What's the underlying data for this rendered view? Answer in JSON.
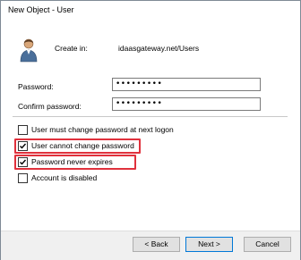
{
  "window": {
    "title": "New Object - User"
  },
  "header": {
    "create_in_label": "Create in:",
    "create_in_path": "idaasgateway.net/Users",
    "icon": "user-icon"
  },
  "fields": {
    "password": {
      "label": "Password:",
      "value": "•••••••••"
    },
    "confirm_password": {
      "label": "Confirm password:",
      "value": "•••••••••"
    }
  },
  "options": [
    {
      "label": "User must change password at next logon",
      "checked": false,
      "highlighted": false
    },
    {
      "label": "User cannot change password",
      "checked": true,
      "highlighted": true
    },
    {
      "label": "Password never expires",
      "checked": true,
      "highlighted": true
    },
    {
      "label": "Account is disabled",
      "checked": false,
      "highlighted": false
    }
  ],
  "buttons": {
    "back": "< Back",
    "next": "Next >",
    "cancel": "Cancel"
  },
  "colors": {
    "highlight": "#e0313c",
    "default_button_border": "#0078d7",
    "dialog_bg": "#f0f0f0"
  }
}
